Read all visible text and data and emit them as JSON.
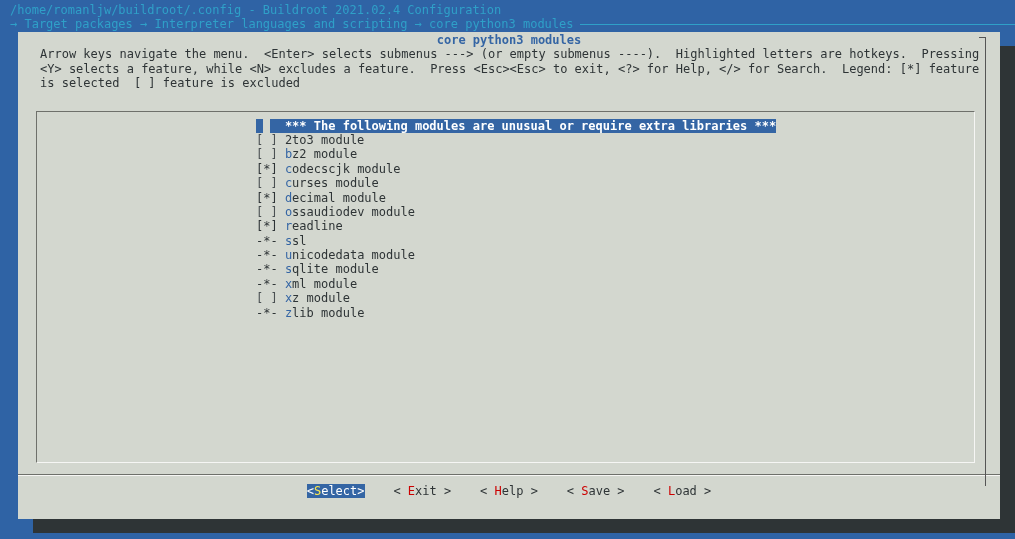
{
  "window": {
    "title": "/home/romanljw/buildroot/.config - Buildroot 2021.02.4 Configuration",
    "breadcrumb": "→ Target packages → Interpreter languages and scripting → core python3 modules"
  },
  "dialog": {
    "title": "core python3 modules",
    "help_lines": [
      "Arrow keys navigate the menu.  <Enter> selects submenus ---> (or empty submenus ----).  Highlighted letters are hotkeys.  Pressing",
      "<Y> selects a feature, while <N> excludes a feature.  Press <Esc><Esc> to exit, <?> for Help, </> for Search.  Legend: [*] feature",
      "is selected  [ ] feature is excluded"
    ],
    "items": [
      {
        "kind": "comment",
        "label": "*** The following modules are unusual or require extra libraries ***",
        "selected": true
      },
      {
        "kind": "option",
        "box": "[ ]",
        "checked": false,
        "label": "2to3 module",
        "selected": false
      },
      {
        "kind": "option",
        "box": "[ ]",
        "checked": false,
        "hotkey": "b",
        "label": "z2 module",
        "selected": false
      },
      {
        "kind": "option",
        "box": "[*]",
        "checked": true,
        "hotkey": "c",
        "label": "odecscjk module",
        "selected": false
      },
      {
        "kind": "option",
        "box": "[ ]",
        "checked": false,
        "hotkey": "c",
        "label": "urses module",
        "selected": false
      },
      {
        "kind": "option",
        "box": "[*]",
        "checked": true,
        "hotkey": "d",
        "label": "ecimal module",
        "selected": false
      },
      {
        "kind": "option",
        "box": "[ ]",
        "checked": false,
        "hotkey": "o",
        "label": "ssaudiodev module",
        "selected": false
      },
      {
        "kind": "option",
        "box": "[*]",
        "checked": true,
        "hotkey": "r",
        "label": "eadline",
        "selected": false
      },
      {
        "kind": "option",
        "box": "-*-",
        "checked": true,
        "hotkey": "s",
        "label": "sl",
        "selected": false
      },
      {
        "kind": "option",
        "box": "-*-",
        "checked": true,
        "hotkey": "u",
        "label": "nicodedata module",
        "selected": false
      },
      {
        "kind": "option",
        "box": "-*-",
        "checked": true,
        "hotkey": "s",
        "label": "qlite module",
        "selected": false
      },
      {
        "kind": "option",
        "box": "-*-",
        "checked": true,
        "hotkey": "x",
        "label": "ml module",
        "selected": false
      },
      {
        "kind": "option",
        "box": "[ ]",
        "checked": false,
        "hotkey": "x",
        "label": "z module",
        "selected": false
      },
      {
        "kind": "option",
        "box": "-*-",
        "checked": true,
        "hotkey": "z",
        "label": "lib module",
        "selected": false
      }
    ],
    "buttons": [
      {
        "before": "<",
        "hotkey": "S",
        "after": "elect>",
        "selected": true
      },
      {
        "before": "< ",
        "hotkey": "E",
        "after": "xit >",
        "selected": false
      },
      {
        "before": "< ",
        "hotkey": "H",
        "after": "elp >",
        "selected": false
      },
      {
        "before": "< ",
        "hotkey": "S",
        "after": "ave >",
        "selected": false
      },
      {
        "before": "< ",
        "hotkey": "L",
        "after": "oad >",
        "selected": false
      }
    ]
  }
}
